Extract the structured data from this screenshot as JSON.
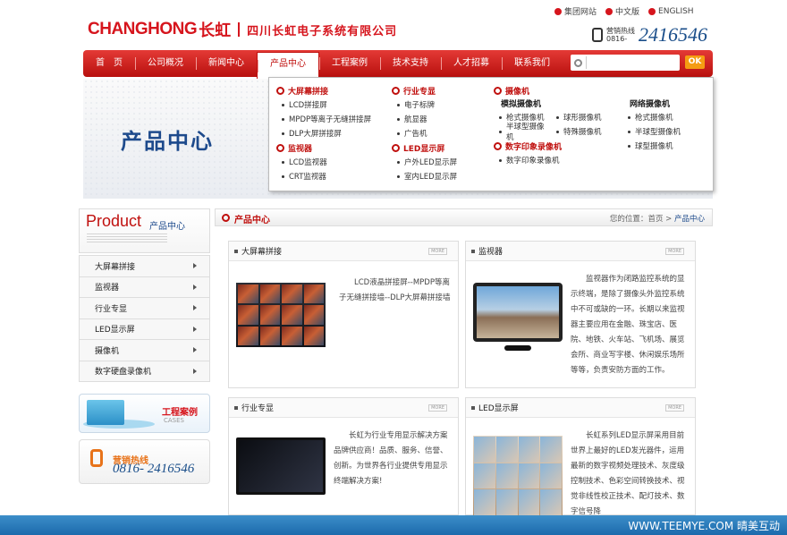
{
  "header": {
    "brand": "CHANGHONG",
    "brand_cn": "长虹",
    "company": "四川长虹电子系统有限公司",
    "top_links": [
      "集团网站",
      "中文版",
      "ENGLISH"
    ],
    "hotline_label_1": "营销热线",
    "hotline_label_2": "0816-",
    "hotline_number": "2416546"
  },
  "nav": {
    "items": [
      "首　页",
      "公司概况",
      "新闻中心",
      "产品中心",
      "工程案例",
      "技术支持",
      "人才招募",
      "联系我们"
    ],
    "active": "产品中心",
    "search_placeholder": "",
    "ok_label": "OK"
  },
  "banner": {
    "title": "产品中心"
  },
  "dropdown": {
    "col1": {
      "groups": [
        {
          "title": "大屏幕拼接",
          "items": [
            "LCD拼接屏",
            "MPDP等离子无缝拼接屏",
            "DLP大屏拼接屏"
          ]
        },
        {
          "title": "监视器",
          "items": [
            "LCD监视器",
            "CRT监视器"
          ]
        }
      ]
    },
    "col2": {
      "groups": [
        {
          "title": "行业专显",
          "items": [
            "电子标牌",
            "航显器",
            "广告机"
          ]
        },
        {
          "title": "LED显示屏",
          "items": [
            "户外LED显示屏",
            "室内LED显示屏"
          ]
        }
      ]
    },
    "col3": {
      "title": "摄像机",
      "analog_title": "模拟摄像机",
      "analog_items": [
        "枪式摄像机",
        "球形摄像机",
        "半球型摄像机",
        "特殊摄像机"
      ],
      "dvr_title": "数字印象录像机",
      "dvr_items": [
        "数字印象录像机"
      ]
    },
    "col4": {
      "title": "网络摄像机",
      "items": [
        "枪式摄像机",
        "半球型摄像机",
        "球型摄像机"
      ]
    }
  },
  "sidebar": {
    "title_en": "Product",
    "title_cn": "产品中心",
    "items": [
      "大屏幕拼接",
      "监视器",
      "行业专显",
      "LED显示屏",
      "摄像机",
      "数字硬盘录像机"
    ],
    "cases_title": "工程案例",
    "cases_en": "CASES",
    "hotline_title": "营销热线",
    "hotline_number": "0816- 2416546"
  },
  "main": {
    "title": "产品中心",
    "breadcrumb_label": "您的位置：",
    "breadcrumb_home": "首页",
    "breadcrumb_sep": ">",
    "breadcrumb_current": "产品中心",
    "more_label": "MORE",
    "cards": [
      {
        "title": "大屏幕拼接",
        "text": "LCD液晶拼接屏--MPDP等离子无缝拼接墙--DLP大屏幕拼接墙"
      },
      {
        "title": "监视器",
        "text": "监视器作为闭路监控系统的显示终端，是除了摄像头外监控系统中不可或缺的一环。长期以来监视器主要应用在金融、珠宝店、医院、地铁、火车站、飞机场、展览会所、商业写字楼、休闲娱乐场所等等，负责安防方面的工作。"
      },
      {
        "title": "行业专显",
        "text": "长虹为行业专用显示解决方案品牌供应商！品质、服务、信誉、创新。为世界各行业提供专用显示终端解决方案!"
      },
      {
        "title": "LED显示屏",
        "text": "长虹系列LED显示屏采用目前世界上最好的LED发光器件，运用最新的数字视频处理技术、灰度级控制技术、色彩空间转换技术、视觉非线性校正技术、配灯技术、数字信号降"
      }
    ]
  },
  "footer": {
    "text": "WWW.TEEMYE.COM  晴美互动"
  }
}
